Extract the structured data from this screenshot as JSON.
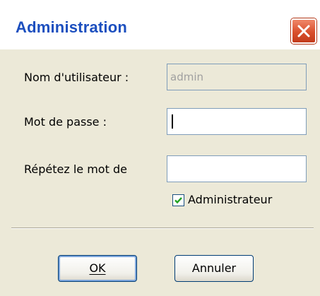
{
  "window": {
    "title": "Administration"
  },
  "form": {
    "username_label": "Nom d'utilisateur :",
    "username_value": "admin",
    "password_label": "Mot de passe :",
    "password_value": "",
    "repeat_label": "Répétez le mot de",
    "repeat_value": "",
    "admin_checkbox_label": "Administrateur",
    "admin_checked": true
  },
  "buttons": {
    "ok_label": "OK",
    "cancel_label": "Annuler"
  },
  "icons": {
    "close": "close-icon",
    "check": "checkmark-icon"
  },
  "colors": {
    "title": "#1c4fbf",
    "close_button": "#d94f2c",
    "dialog_bg": "#ece9d8",
    "check": "#21a121"
  }
}
